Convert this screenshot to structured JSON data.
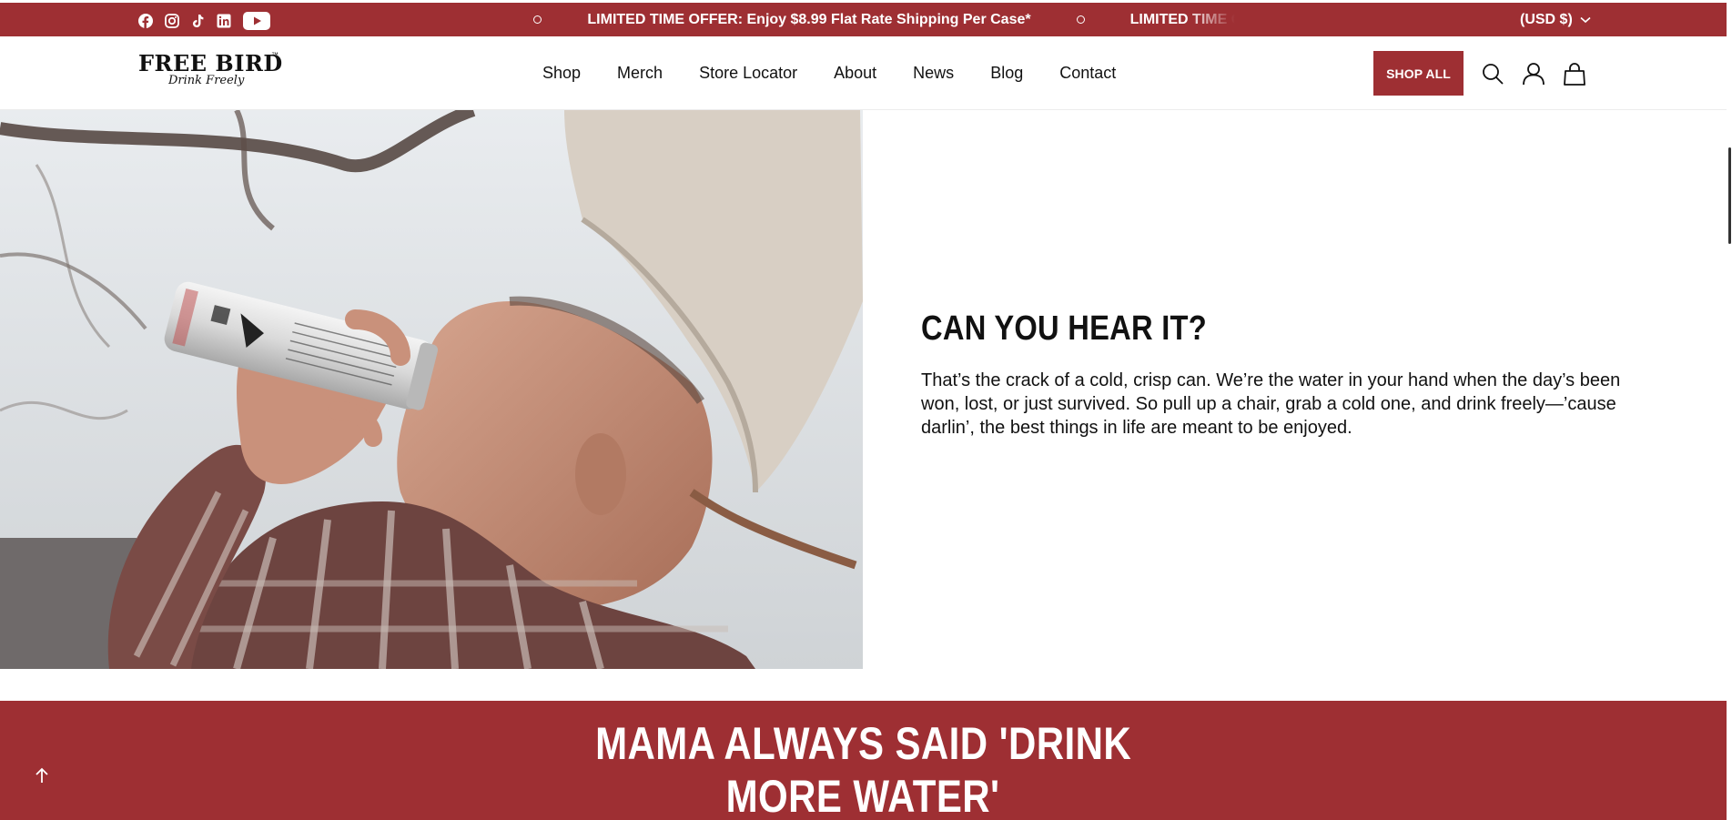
{
  "announcement": {
    "social": [
      {
        "name": "facebook-icon"
      },
      {
        "name": "instagram-icon"
      },
      {
        "name": "tiktok-icon"
      },
      {
        "name": "linkedin-icon"
      },
      {
        "name": "youtube-icon"
      }
    ],
    "offer_text": "LIMITED TIME OFFER: Enjoy $8.99 Flat Rate Shipping Per Case*",
    "currency": "(USD $)"
  },
  "header": {
    "logo_main": "FREE BIRD",
    "logo_tm": "™",
    "logo_tagline": "Drink Freely",
    "nav": [
      "Shop",
      "Merch",
      "Store Locator",
      "About",
      "News",
      "Blog",
      "Contact"
    ],
    "shop_all": "SHOP ALL"
  },
  "hero": {
    "image": "man-drinking-can-photo",
    "title": "CAN YOU HEAR IT?",
    "body": "That’s the crack of a cold, crisp can. We’re the water in your hand when the day’s been won, lost, or just survived. So pull up a chair, grab a cold one, and drink freely—’cause darlin’, the best things in life are meant to be enjoyed."
  },
  "band": {
    "line1": "MAMA ALWAYS SAID 'DRINK",
    "line2": "MORE WATER'"
  },
  "colors": {
    "brand_red": "#9e2f33",
    "text": "#111111",
    "white": "#ffffff"
  }
}
